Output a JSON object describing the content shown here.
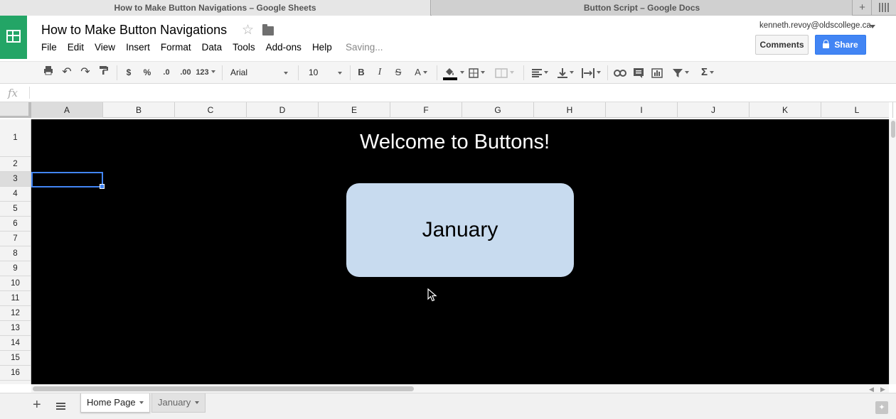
{
  "browser": {
    "tabs": [
      {
        "title": "How to Make Button Navigations – Google Sheets"
      },
      {
        "title": "Button Script – Google Docs"
      }
    ]
  },
  "app": {
    "title": "How to Make Button Navigations",
    "menu": [
      "File",
      "Edit",
      "View",
      "Insert",
      "Format",
      "Data",
      "Tools",
      "Add-ons",
      "Help"
    ],
    "status": "Saving...",
    "account": "kenneth.revoy@oldscollege.ca",
    "comments_label": "Comments",
    "share_label": "Share",
    "brand_color": "#23a566",
    "share_color": "#4285f4"
  },
  "toolbar": {
    "currency": "$",
    "percent": "%",
    "decrease_decimals": ".0",
    "increase_decimals": ".00",
    "more_formats": "123",
    "font": "Arial",
    "font_size": "10",
    "bold": "B",
    "italic": "I",
    "strike": "S",
    "text_color": "A",
    "sum": "Σ"
  },
  "formula_bar": {
    "fx": "fx",
    "value": ""
  },
  "grid": {
    "columns": [
      "A",
      "B",
      "C",
      "D",
      "E",
      "F",
      "G",
      "H",
      "I",
      "J",
      "K",
      "L"
    ],
    "rows": [
      "1",
      "2",
      "3",
      "4",
      "5",
      "6",
      "7",
      "8",
      "9",
      "10",
      "11",
      "12",
      "13",
      "14",
      "15",
      "16"
    ],
    "selected_cell": "A3",
    "background": "#000000"
  },
  "content": {
    "heading": "Welcome to Buttons!",
    "button_label": "January",
    "button_color": "#c8dbef"
  },
  "sheets": {
    "tabs": [
      "Home Page",
      "January"
    ],
    "active": "Home Page"
  }
}
